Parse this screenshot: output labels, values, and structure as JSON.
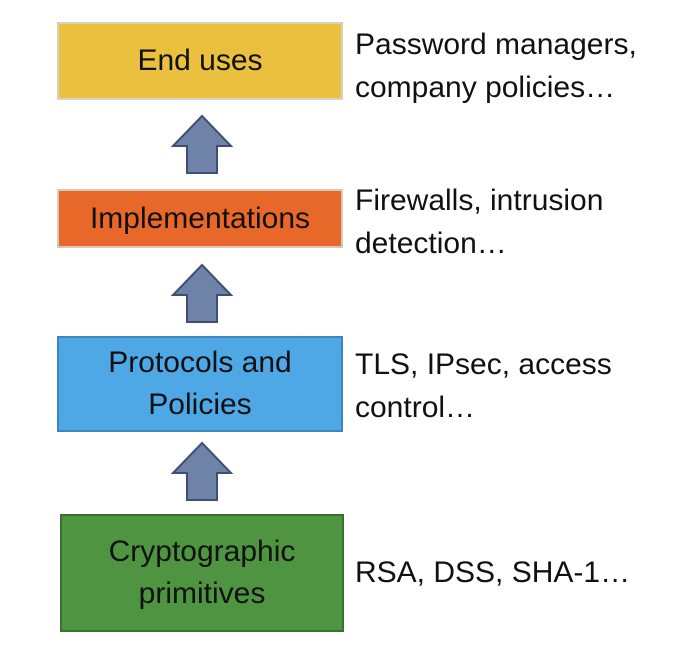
{
  "layers": [
    {
      "id": "end-uses",
      "label": "End uses",
      "color": "#ebc03e",
      "border": "#d6d2c0",
      "example": "Password managers,\ncompany policies…"
    },
    {
      "id": "implementations",
      "label": "Implementations",
      "color": "#e8682a",
      "border": "#d9c6bc",
      "example": "Firewalls, intrusion\ndetection…"
    },
    {
      "id": "protocols",
      "label": "Protocols and\nPolicies",
      "color": "#4fa8e6",
      "border": "#3d85bd",
      "example": "TLS, IPsec, access\ncontrol…"
    },
    {
      "id": "primitives",
      "label": "Cryptographic\nprimitives",
      "color": "#4f9441",
      "border": "#3b6f30",
      "example": "RSA, DSS, SHA-1…"
    }
  ],
  "arrow_color": "#6f82a8",
  "arrow_border": "#3f4f73"
}
